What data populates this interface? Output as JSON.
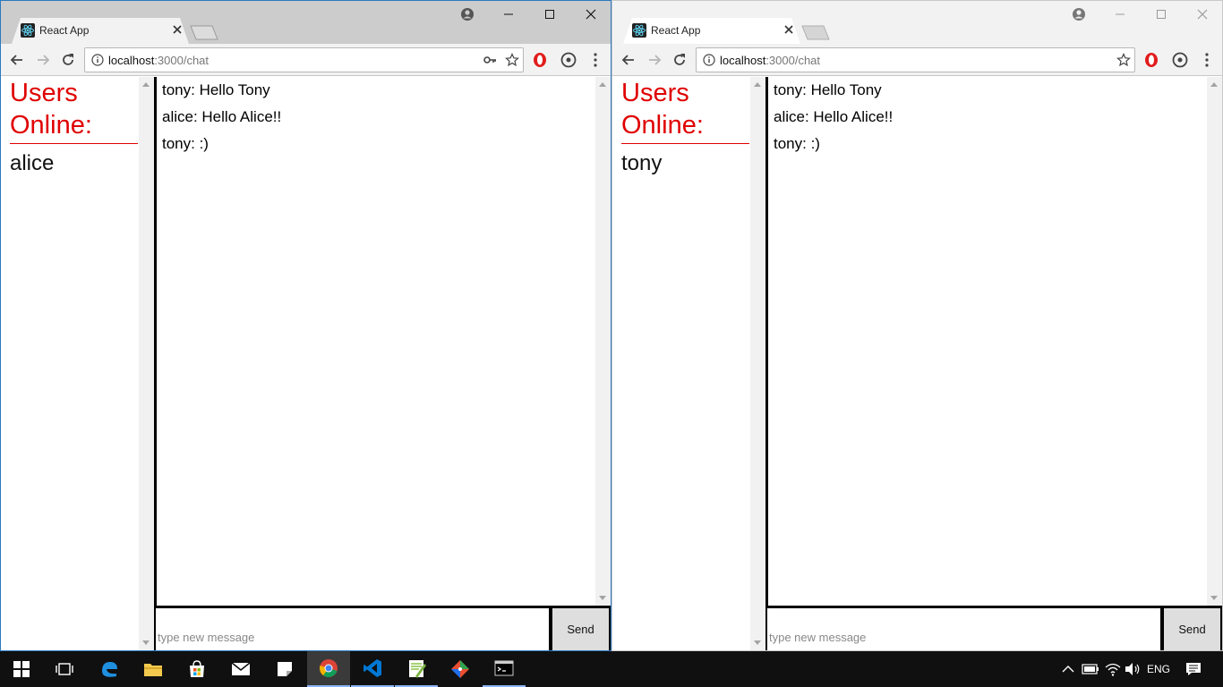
{
  "windows": [
    {
      "tab_title": "React App",
      "url_host": "localhost",
      "url_path": ":3000/chat",
      "sidebar_heading_1": "Users",
      "sidebar_heading_2": "Online:",
      "online_user": "alice",
      "messages": [
        "tony: Hello Tony",
        "alice: Hello Alice!!",
        "tony: :)"
      ],
      "input_placeholder": "type new message",
      "send_label": "Send"
    },
    {
      "tab_title": "React App",
      "url_host": "localhost",
      "url_path": ":3000/chat",
      "sidebar_heading_1": "Users",
      "sidebar_heading_2": "Online:",
      "online_user": "tony",
      "messages": [
        "tony: Hello Tony",
        "alice: Hello Alice!!",
        "tony: :)"
      ],
      "input_placeholder": "type new message",
      "send_label": "Send"
    }
  ],
  "taskbar": {
    "language": "ENG",
    "apps": [
      "start",
      "task-view",
      "edge",
      "file-explorer",
      "store",
      "mail",
      "sticky-notes",
      "chrome",
      "vscode",
      "notepad-plus-plus",
      "git-gui",
      "command-prompt"
    ]
  },
  "colors": {
    "heading_red": "#e00000",
    "active_window_border": "#2b79c2"
  }
}
